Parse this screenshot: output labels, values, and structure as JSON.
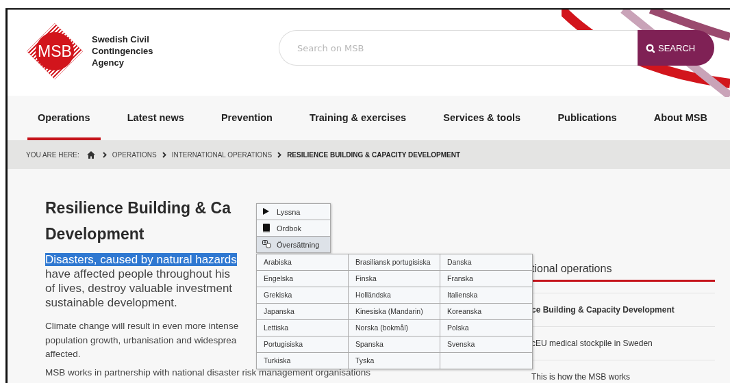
{
  "header": {
    "logo_text": "MSB",
    "agency_name": [
      "Swedish Civil",
      "Contingencies",
      "Agency"
    ],
    "search": {
      "placeholder": "Search on MSB",
      "button": "SEARCH"
    }
  },
  "nav": [
    {
      "label": "Operations",
      "selected": true
    },
    {
      "label": "Latest news",
      "selected": false
    },
    {
      "label": "Prevention",
      "selected": false
    },
    {
      "label": "Training & exercises",
      "selected": false
    },
    {
      "label": "Services & tools",
      "selected": false
    },
    {
      "label": "Publications",
      "selected": false
    },
    {
      "label": "About MSB",
      "selected": false
    }
  ],
  "breadcrumb": {
    "prefix": "YOU ARE HERE:",
    "items": [
      {
        "label": "OPERATIONS",
        "current": false
      },
      {
        "label": "INTERNATIONAL OPERATIONS",
        "current": false
      },
      {
        "label": "RESILIENCE BUILDING & CAPACITY DEVELOPMENT",
        "current": true
      }
    ]
  },
  "article": {
    "title_lines": [
      "Resilience Building & Ca",
      "Development"
    ],
    "lead_lines": [
      {
        "text": "Disasters, caused by natural hazards",
        "highlighted": true
      },
      {
        "text": "have affected people throughout his",
        "highlighted": false
      },
      {
        "text": "of lives, destroy valuable investment",
        "highlighted": false
      },
      {
        "text": "sustainable development.",
        "highlighted": false
      }
    ],
    "body_lines": [
      "Climate change will result in even more intense",
      "population growth, urbanisation and widesprea",
      "affected."
    ],
    "last_line": "MSB works in partnership with national disaster risk management organisations"
  },
  "sidebar": {
    "heading": "tional operations",
    "items": [
      {
        "label": "ce Building & Capacity Development",
        "selected": true
      },
      {
        "label": "cEU medical stockpile in Sweden",
        "selected": false
      },
      {
        "label": "This is how the MSB works",
        "selected": false
      }
    ]
  },
  "context_menu": {
    "items": [
      {
        "kind": "play",
        "label": "Lyssna",
        "selected": false
      },
      {
        "kind": "book",
        "label": "Ordbok",
        "selected": false
      },
      {
        "kind": "translate",
        "label": "Översättning",
        "selected": true
      }
    ],
    "languages": [
      [
        "Arabiska",
        "Brasiliansk portugisiska",
        "Danska"
      ],
      [
        "Engelska",
        "Finska",
        "Franska"
      ],
      [
        "Grekiska",
        "Holländska",
        "Italienska"
      ],
      [
        "Japanska",
        "Kinesiska (Mandarin)",
        "Koreanska"
      ],
      [
        "Lettiska",
        "Norska (bokmål)",
        "Polska"
      ],
      [
        "Portugisiska",
        "Spanska",
        "Svenska"
      ],
      [
        "Turkiska",
        "Tyska"
      ]
    ]
  }
}
